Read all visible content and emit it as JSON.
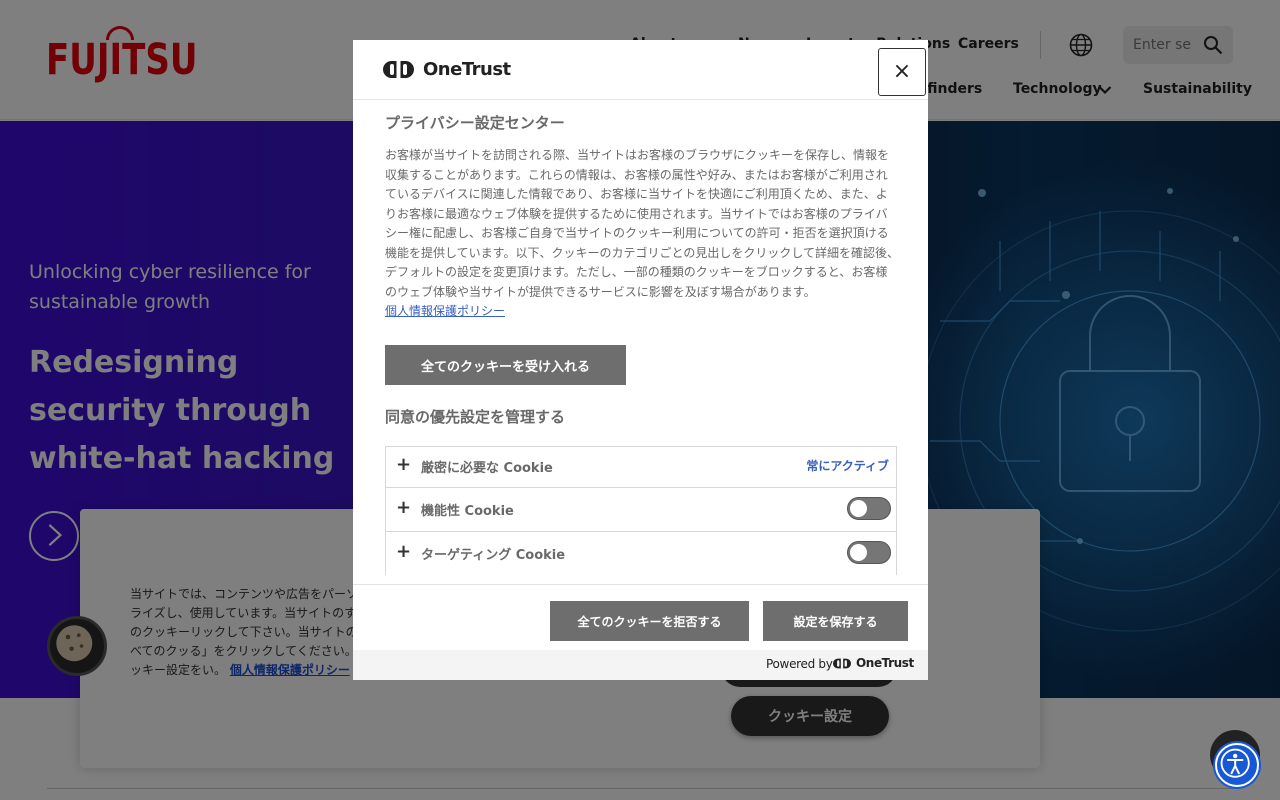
{
  "header": {
    "logo_text": "FUJITSU",
    "top_links": [
      "About us",
      "News",
      "Investor Relations"
    ],
    "careers_label": "Careers",
    "search_placeholder": "Enter se",
    "nav": {
      "partial_label": "yfinders",
      "technology_label": "Technology",
      "sustainability_label": "Sustainability"
    }
  },
  "hero": {
    "subtitle": "Unlocking cyber resilience for sustainable growth",
    "title": "Redesigning security through white-hat hacking"
  },
  "banner": {
    "text": "当サイトでは、コンテンツや広告をパーソナライズし、使用しています。当サイトのすべてのクッキーリックして下さい。当サイトのすべてのクッる」をクリックしてください。クッキー設定をい。",
    "privacy_link": "個人情報保護ポリシー",
    "settings_button": "クッキー設定"
  },
  "modal": {
    "brand": "OneTrust",
    "close_label": "×",
    "title": "プライバシー設定センター",
    "description": "お客様が当サイトを訪問される際、当サイトはお客様のブラウザにクッキーを保存し、情報を収集することがあります。これらの情報は、お客様の属性や好み、またはお客様がご利用されているデバイスに関連した情報であり、お客様に当サイトを快適にご利用頂くため、また、よりお客様に最適なウェブ体験を提供するために使用されます。当サイトではお客様のプライバシー権に配慮し、お客様ご自身で当サイトのクッキー利用についての許可・拒否を選択頂ける機能を提供しています。以下、クッキーのカテゴリごとの見出しをクリックして詳細を確認後、デフォルトの設定を変更頂けます。ただし、一部の種類のクッキーをブロックすると、お客様のウェブ体験や当サイトが提供できるサービスに影響を及ぼす場合があります。",
    "privacy_link": "個人情報保護ポリシー",
    "accept_all": "全てのクッキーを受け入れる",
    "manage_title": "同意の優先設定を管理する",
    "categories": [
      {
        "name": "厳密に必要な Cookie",
        "status": "常にアクティブ"
      },
      {
        "name": "機能性 Cookie",
        "enabled": false
      },
      {
        "name": "ターゲティング Cookie",
        "enabled": false
      }
    ],
    "reject_all": "全てのクッキーを拒否する",
    "save_settings": "設定を保存する",
    "powered_by": "Powered by",
    "powered_brand": "OneTrust"
  },
  "colors": {
    "fujitsu_red": "#e4000f",
    "hero_violet": "#3f0cd6",
    "modal_button": "#6e6e6e",
    "link_blue": "#3860be",
    "a11y_blue": "#1758d6"
  }
}
